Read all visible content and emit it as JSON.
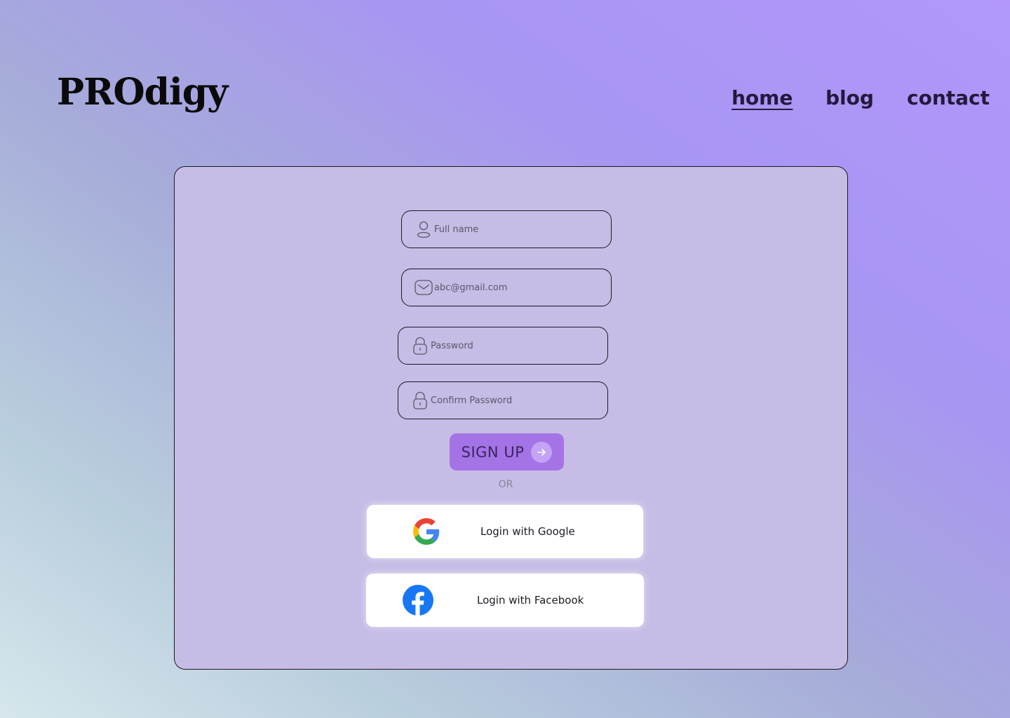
{
  "brand": {
    "logo": "PROdigy"
  },
  "nav": {
    "items": [
      {
        "label": "home",
        "active": true
      },
      {
        "label": "blog",
        "active": false
      },
      {
        "label": "contact",
        "active": false
      }
    ]
  },
  "form": {
    "full_name": {
      "placeholder": "Full name",
      "value": "",
      "icon": "user-icon"
    },
    "email": {
      "placeholder": "abc@gmail.com",
      "value": "",
      "icon": "mail-icon"
    },
    "password": {
      "placeholder": "Password",
      "value": "",
      "icon": "lock-icon"
    },
    "confirm_password": {
      "placeholder": "Confirm Password",
      "value": "",
      "icon": "lock-icon"
    },
    "signup_label": "SIGN UP",
    "or_label": "OR"
  },
  "social": {
    "google_label": "Login with Google",
    "facebook_label": "Login with Facebook"
  },
  "colors": {
    "card": "#c7bce6",
    "signup_button": "#a474e6",
    "facebook_blue": "#1877f2"
  }
}
